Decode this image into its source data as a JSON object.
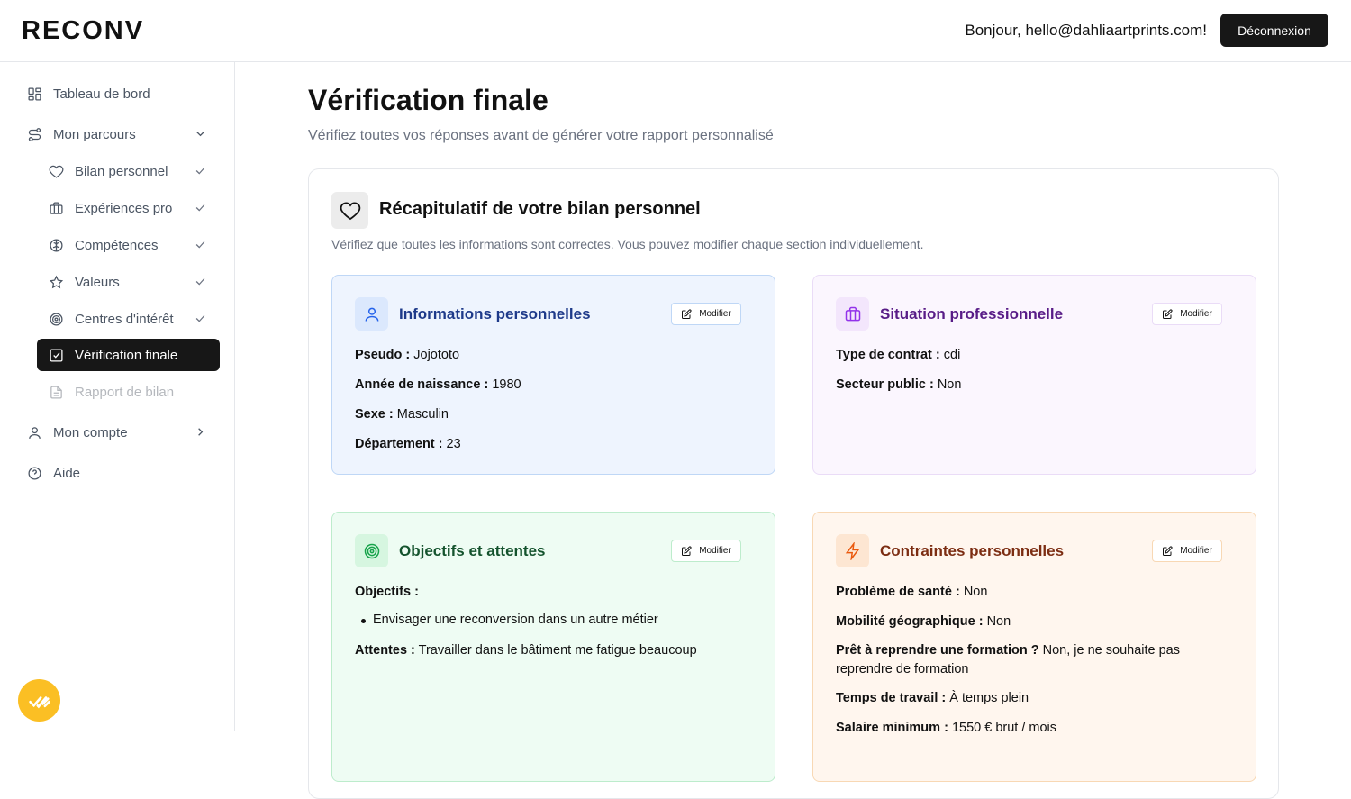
{
  "header": {
    "logo": "RECONV",
    "greeting": "Bonjour, hello@dahliaartprints.com!",
    "logout_label": "Déconnexion"
  },
  "sidebar": {
    "dashboard": "Tableau de bord",
    "journey": "Mon parcours",
    "steps": [
      {
        "label": "Bilan personnel",
        "icon": "heart-icon",
        "done": true
      },
      {
        "label": "Expériences pro",
        "icon": "briefcase-icon",
        "done": true
      },
      {
        "label": "Compétences",
        "icon": "brain-icon",
        "done": true
      },
      {
        "label": "Valeurs",
        "icon": "star-icon",
        "done": true
      },
      {
        "label": "Centres d'intérêt",
        "icon": "target-icon",
        "done": true
      },
      {
        "label": "Vérification finale",
        "icon": "checkbox-icon",
        "active": true
      },
      {
        "label": "Rapport de bilan",
        "icon": "file-icon",
        "disabled": true
      }
    ],
    "account": "Mon compte",
    "help": "Aide"
  },
  "main": {
    "title": "Vérification finale",
    "subtitle": "Vérifiez toutes vos réponses avant de générer votre rapport personnalisé",
    "panel": {
      "title": "Récapitulatif de votre bilan personnel",
      "subtitle": "Vérifiez que toutes les informations sont correctes. Vous pouvez modifier chaque section individuellement."
    },
    "edit_label": "Modifier",
    "personal": {
      "title": "Informations personnelles",
      "fields": [
        {
          "label": "Pseudo :",
          "value": "Jojototo"
        },
        {
          "label": "Année de naissance :",
          "value": "1980"
        },
        {
          "label": "Sexe :",
          "value": "Masculin"
        },
        {
          "label": "Département :",
          "value": "23"
        }
      ]
    },
    "professional": {
      "title": "Situation professionnelle",
      "fields": [
        {
          "label": "Type de contrat :",
          "value": "cdi"
        },
        {
          "label": "Secteur public :",
          "value": "Non"
        }
      ]
    },
    "goals": {
      "title": "Objectifs et attentes",
      "objectives_label": "Objectifs :",
      "objectives": [
        "Envisager une reconversion dans un autre métier"
      ],
      "expectations_label": "Attentes :",
      "expectations": "Travailler dans le bâtiment me fatigue beaucoup"
    },
    "constraints": {
      "title": "Contraintes personnelles",
      "fields": [
        {
          "label": "Problème de santé :",
          "value": "Non"
        },
        {
          "label": "Mobilité géographique :",
          "value": "Non"
        },
        {
          "label": "Prêt à reprendre une formation ?",
          "value": "Non, je ne souhaite pas reprendre de formation"
        },
        {
          "label": "Temps de travail :",
          "value": "À temps plein"
        },
        {
          "label": "Salaire minimum :",
          "value": "1550 € brut / mois"
        }
      ]
    }
  },
  "colors": {
    "accent": "#171717",
    "fab": "#fbbf24",
    "blue": "#1e3a8a",
    "purple": "#581c87",
    "green": "#14532d",
    "orange": "#7c2d12"
  }
}
